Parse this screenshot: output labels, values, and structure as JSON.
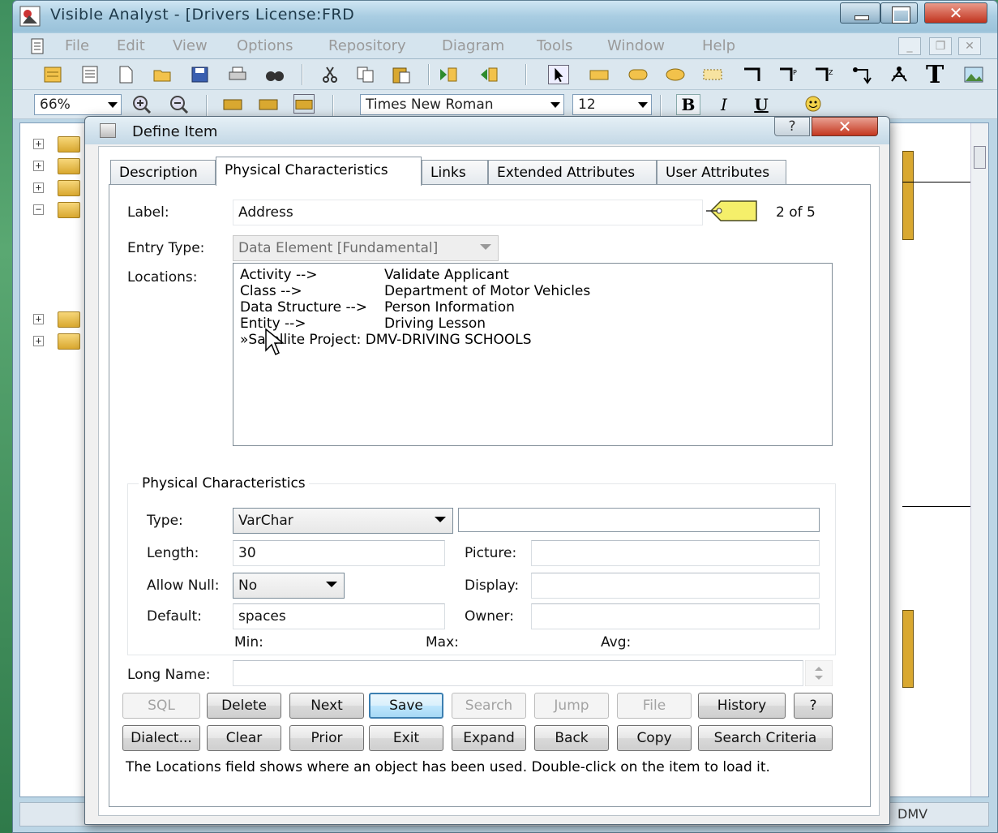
{
  "window": {
    "title": "Visible Analyst - [Drivers License:FRD"
  },
  "menu": {
    "items": [
      "File",
      "Edit",
      "View",
      "Options",
      "Repository",
      "Diagram",
      "Tools",
      "Window",
      "Help"
    ]
  },
  "toolbar": {
    "zoom": "66%",
    "font": "Times New Roman",
    "font_size": "12",
    "bold": "B",
    "italic": "I",
    "underline": "U",
    "text_tool": "T"
  },
  "status": {
    "right_text": "DMV"
  },
  "dialog": {
    "title": "Define Item",
    "help_label": "?",
    "close_label": "✕",
    "tabs": [
      "Description",
      "Physical Characteristics",
      "Links",
      "Extended Attributes",
      "User Attributes"
    ],
    "active_tab": "Physical Characteristics",
    "label_caption": "Label:",
    "label_value": "Address",
    "counter": "2 of 5",
    "entry_type_caption": "Entry Type:",
    "entry_type_value": "Data Element [Fundamental]",
    "locations_caption": "Locations:",
    "locations": [
      {
        "kind": "Activity -->",
        "name": "Validate Applicant"
      },
      {
        "kind": "Class -->",
        "name": "Department of Motor Vehicles"
      },
      {
        "kind": "Data Structure -->",
        "name": "Person Information"
      },
      {
        "kind": "Entity -->",
        "name": "Driving Lesson"
      },
      {
        "kind": "»Satellite Project: DMV-DRIVING SCHOOLS",
        "name": ""
      }
    ],
    "physical": {
      "group_title": "Physical Characteristics",
      "type_caption": "Type:",
      "type_value": "VarChar",
      "type_extra": "",
      "length_caption": "Length:",
      "length_value": "30",
      "picture_caption": "Picture:",
      "picture_value": "",
      "allow_null_caption": "Allow Null:",
      "allow_null_value": "No",
      "display_caption": "Display:",
      "display_value": "",
      "default_caption": "Default:",
      "default_value": "spaces",
      "owner_caption": "Owner:",
      "owner_value": "",
      "min_caption": "Min:",
      "max_caption": "Max:",
      "avg_caption": "Avg:"
    },
    "long_name_caption": "Long Name:",
    "long_name_value": "",
    "buttons_row1": [
      "SQL",
      "Delete",
      "Next",
      "Save",
      "Search",
      "Jump",
      "File",
      "History",
      "?"
    ],
    "buttons_row2": [
      "Dialect...",
      "Clear",
      "Prior",
      "Exit",
      "Expand",
      "Back",
      "Copy",
      "Search Criteria"
    ],
    "hint": "The Locations field shows where an object has been used. Double-click on the item to load it."
  },
  "colors": {
    "title_blue": "#a9cde2",
    "close_red": "#c4371f",
    "default_button_border": "#3c7fb1",
    "folder_yellow": "#f7d77a"
  }
}
